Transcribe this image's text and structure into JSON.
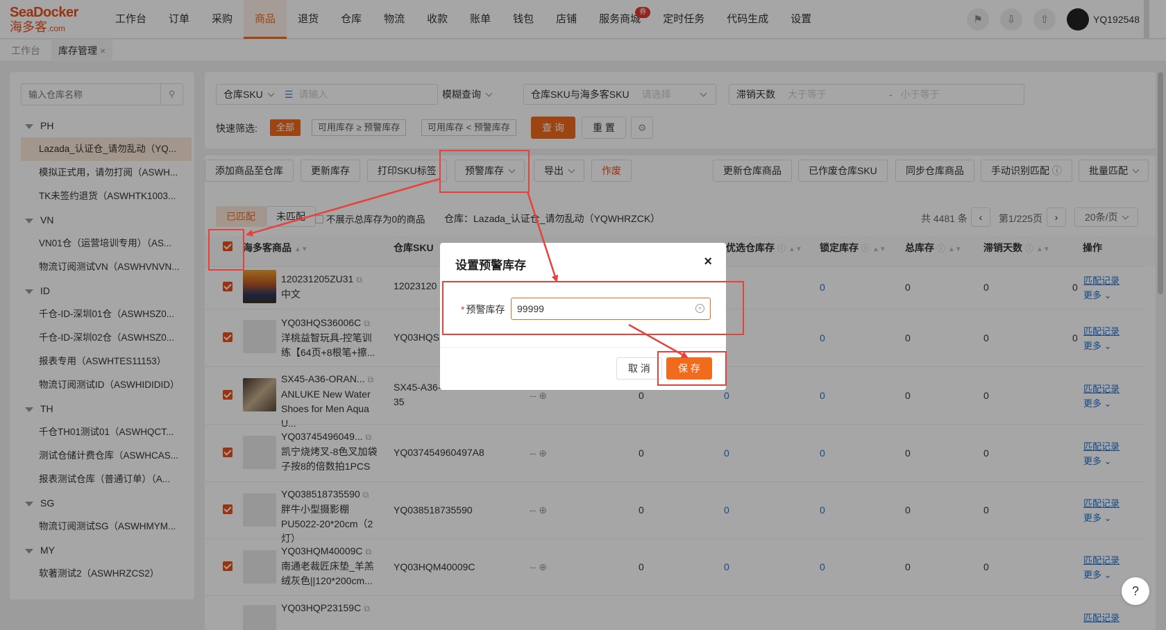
{
  "brand": {
    "name_en": "SeaDocker",
    "name_cn": "海多客",
    "suffix": ".com"
  },
  "nav": {
    "items": [
      "工作台",
      "订单",
      "采购",
      "商品",
      "退货",
      "仓库",
      "物流",
      "收款",
      "账单",
      "钱包",
      "店铺",
      "服务商城",
      "定时任务",
      "代码生成",
      "设置"
    ],
    "active": "商品",
    "badge": "券"
  },
  "user": {
    "name": "YQ192548"
  },
  "page_tabs": [
    {
      "label": "工作台"
    },
    {
      "label": "库存管理",
      "close": "×"
    }
  ],
  "sidebar": {
    "search_placeholder": "输入仓库名称",
    "groups": [
      {
        "name": "PH",
        "items": [
          "Lazada_认证仓_请勿乱动（YQ...",
          "模拟正式用，请勿打阅（ASWH...",
          "TK未签约退货（ASWHTK1003..."
        ]
      },
      {
        "name": "VN",
        "items": [
          "VN01仓（运营培训专用）（AS...",
          "物流订阅测试VN（ASWHVNVN..."
        ]
      },
      {
        "name": "ID",
        "items": [
          "千仓-ID-深圳01仓（ASWHSZ0...",
          "千仓-ID-深圳02仓（ASWHSZ0...",
          "报表专用（ASWHTES11153）",
          "物流订阅测试ID（ASWHIDIDID）"
        ]
      },
      {
        "name": "TH",
        "items": [
          "千仓TH01测试01（ASWHQCT...",
          "测试仓储计费仓库（ASWHCAS...",
          "报表测试仓库（普通订单）（A..."
        ]
      },
      {
        "name": "SG",
        "items": [
          "物流订阅测试SG（ASWHMYM..."
        ]
      },
      {
        "name": "MY",
        "items": [
          "软著测试2（ASWHRZCS2）"
        ]
      }
    ],
    "selected": "Lazada_认证仓_请勿乱动（YQ..."
  },
  "filters": {
    "sku_type": "仓库SKU",
    "sku_placeholder": "请输入",
    "match_mode": "模糊查询",
    "mapping_label": "仓库SKU与海多客SKU",
    "mapping_placeholder": "请选择",
    "stagnant_label": "滞销天数",
    "stagnant_min_placeholder": "大于等于",
    "stagnant_max_placeholder": "小于等于",
    "range_sep": "-",
    "quick_label": "快速筛选:",
    "quick_chips": [
      "全部",
      "可用库存 ≥ 预警库存",
      "可用库存 < 预警库存"
    ],
    "search_btn": "查 询",
    "reset_btn": "重 置"
  },
  "toolbar": {
    "left": [
      "添加商品至仓库",
      "更新库存",
      "打印SKU标签",
      "预警库存",
      "导出",
      "作废"
    ],
    "right": [
      "更新仓库商品",
      "已作废仓库SKU",
      "同步仓库商品",
      "手动识别匹配",
      "批量匹配"
    ]
  },
  "list_header": {
    "tabs": [
      "已匹配",
      "未匹配"
    ],
    "hide_zero": "不展示总库存为0的商品",
    "warehouse": "仓库：Lazada_认证仓_请勿乱动（YQWHRZCK）",
    "total": "共 4481 条",
    "page": "第1/225页",
    "page_size": "20条/页"
  },
  "table": {
    "columns": [
      "海多客商品",
      "仓库SKU",
      "优选仓库存",
      "锁定库存",
      "总库存",
      "滞销天数",
      "操作"
    ],
    "rows": [
      {
        "sku": "120231205ZU31",
        "name": "中文",
        "wsku": "12023120",
        "c1": "",
        "c2": "",
        "c3": "0",
        "c4": "0",
        "c5": "0",
        "c6": "0",
        "op1": "匹配记录",
        "op2": "更多"
      },
      {
        "sku": "YQ03HQS36006C",
        "name": "洋桃益智玩具-控笔训练【64页+8根笔+擦...",
        "wsku": "YQ03HQS",
        "c1": "",
        "c2": "",
        "c3": "0",
        "c4": "0",
        "c5": "0",
        "c6": "0",
        "op1": "匹配记录",
        "op2": "更多"
      },
      {
        "sku": "SX45-A36-ORAN...",
        "name": "ANLUKE New Water Shoes for Men Aqua U...",
        "wsku": "SX45-A36-",
        "wsku2": "35",
        "c1": "-- ⊕",
        "c2": "0",
        "c3": "0",
        "c4": "0",
        "c5": "0",
        "c6": "0",
        "op1": "匹配记录",
        "op2": "更多"
      },
      {
        "sku": "YQ03745496049...",
        "name": "凯宁烧烤叉-8色叉加袋子按8的倍数拍1PCS",
        "wsku": "YQ037454960497A8",
        "c1": "-- ⊕",
        "c2": "0",
        "c3": "0",
        "c4": "0",
        "c5": "0",
        "c6": "0",
        "op1": "匹配记录",
        "op2": "更多"
      },
      {
        "sku": "YQ038518735590",
        "name": "胖牛小型摄影棚PU5022-20*20cm（2灯）",
        "wsku": "YQ038518735590",
        "c1": "-- ⊕",
        "c2": "0",
        "c3": "0",
        "c4": "0",
        "c5": "0",
        "c6": "0",
        "op1": "匹配记录",
        "op2": "更多"
      },
      {
        "sku": "YQ03HQM40009C",
        "name": "南通老裁匠床垫_羊羔绒灰色||120*200cm...",
        "wsku": "YQ03HQM40009C",
        "c1": "-- ⊕",
        "c2": "0",
        "c3": "0",
        "c4": "0",
        "c5": "0",
        "c6": "0",
        "op1": "匹配记录",
        "op2": "更多"
      },
      {
        "sku": "YQ03HQP23159C",
        "name": "",
        "wsku": "",
        "op1": "匹配记录"
      }
    ]
  },
  "modal": {
    "title": "设置预警库存",
    "close": "×",
    "required_mark": "*",
    "field_label": "预警库存",
    "field_value": "99999",
    "cancel": "取 消",
    "save": "保 存"
  },
  "help": "?",
  "colors": {
    "accent": "#f26b1d",
    "annotation": "#e8403a",
    "link": "#1f6fd1"
  }
}
